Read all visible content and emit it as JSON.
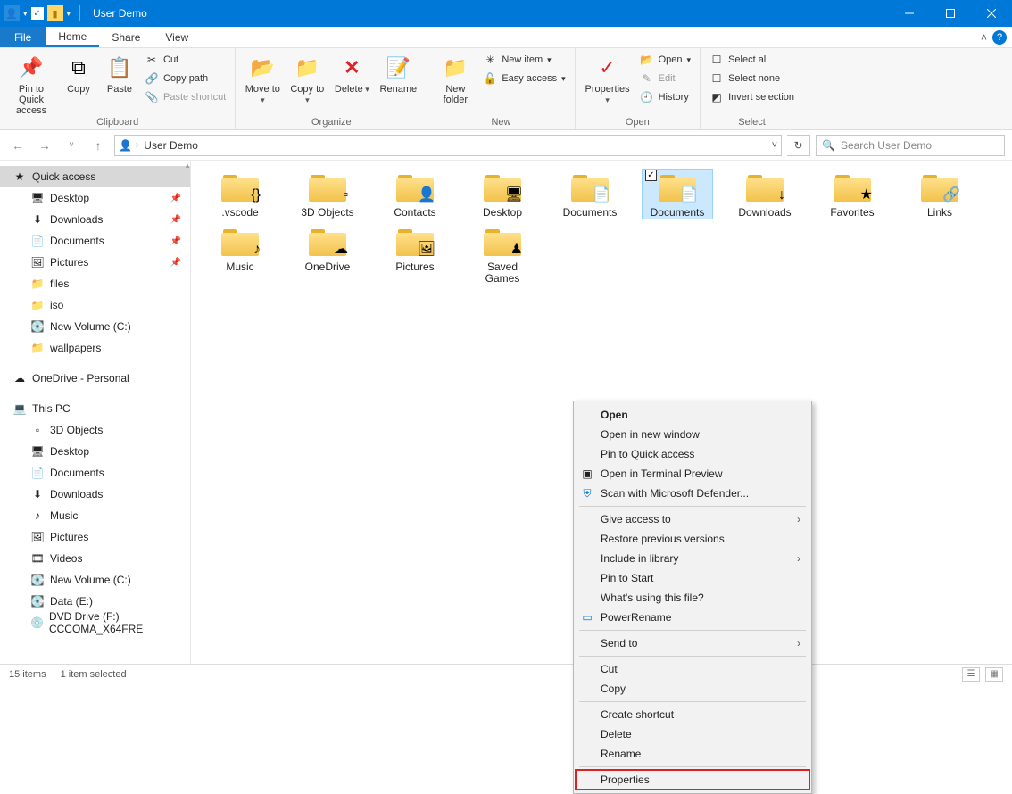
{
  "title": "User Demo",
  "tabs": {
    "file": "File",
    "home": "Home",
    "share": "Share",
    "view": "View"
  },
  "ribbon": {
    "clipboard": {
      "label": "Clipboard",
      "pin": "Pin to Quick access",
      "copy": "Copy",
      "paste": "Paste",
      "cut": "Cut",
      "copypath": "Copy path",
      "pasteshortcut": "Paste shortcut"
    },
    "organize": {
      "label": "Organize",
      "moveto": "Move to",
      "copyto": "Copy to",
      "delete": "Delete",
      "rename": "Rename"
    },
    "new": {
      "label": "New",
      "newfolder": "New folder",
      "newitem": "New item",
      "easyaccess": "Easy access"
    },
    "open": {
      "label": "Open",
      "properties": "Properties",
      "open": "Open",
      "edit": "Edit",
      "history": "History"
    },
    "select": {
      "label": "Select",
      "selectall": "Select all",
      "selectnone": "Select none",
      "invert": "Invert selection"
    }
  },
  "address": {
    "location": "User Demo",
    "search_placeholder": "Search User Demo"
  },
  "sidebar": {
    "quick": "Quick access",
    "qitems": [
      "Desktop",
      "Downloads",
      "Documents",
      "Pictures",
      "files",
      "iso",
      "New Volume (C:)",
      "wallpapers"
    ],
    "onedrive": "OneDrive - Personal",
    "thispc": "This PC",
    "pcitems": [
      "3D Objects",
      "Desktop",
      "Documents",
      "Downloads",
      "Music",
      "Pictures",
      "Videos",
      "New Volume (C:)",
      "Data (E:)",
      "DVD Drive (F:) CCCOMA_X64FRE"
    ]
  },
  "items": [
    {
      "name": ".vscode",
      "overlay": "{}"
    },
    {
      "name": "3D Objects",
      "overlay": "▫"
    },
    {
      "name": "Contacts",
      "overlay": "👤"
    },
    {
      "name": "Desktop",
      "overlay": "🖥"
    },
    {
      "name": "Documents",
      "overlay": "📄"
    },
    {
      "name": "Documents",
      "overlay": "📄",
      "selected": true
    },
    {
      "name": "Downloads",
      "overlay": "↓"
    },
    {
      "name": "Favorites",
      "overlay": "★"
    },
    {
      "name": "Links",
      "overlay": "🔗"
    },
    {
      "name": "Music",
      "overlay": "♪"
    },
    {
      "name": "OneDrive",
      "overlay": "☁"
    },
    {
      "name": "Pictures",
      "overlay": "🖼"
    },
    {
      "name": "Saved Games",
      "overlay": "♟"
    }
  ],
  "context": {
    "open": "Open",
    "opennew": "Open in new window",
    "pinquick": "Pin to Quick access",
    "terminal": "Open in Terminal Preview",
    "defender": "Scan with Microsoft Defender...",
    "giveaccess": "Give access to",
    "restore": "Restore previous versions",
    "include": "Include in library",
    "pinstart": "Pin to Start",
    "whatsusing": "What's using this file?",
    "powerrename": "PowerRename",
    "sendto": "Send to",
    "cut": "Cut",
    "copy": "Copy",
    "shortcut": "Create shortcut",
    "delete": "Delete",
    "rename": "Rename",
    "properties": "Properties"
  },
  "status": {
    "count": "15 items",
    "selected": "1 item selected"
  }
}
